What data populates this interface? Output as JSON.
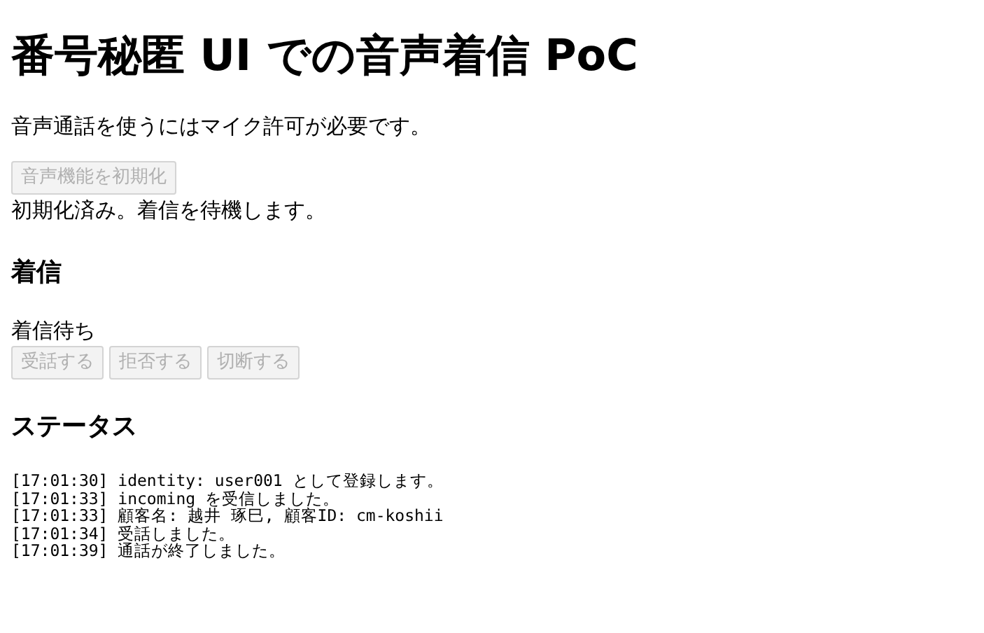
{
  "title": "番号秘匿 UI での音声着信 PoC",
  "intro": "音声通話を使うにはマイク許可が必要です。",
  "init_button": {
    "label": "音声機能を初期化",
    "disabled": true
  },
  "init_status": "初期化済み。着信を待機します。",
  "incoming": {
    "heading": "着信",
    "state": "着信待ち",
    "buttons": [
      {
        "label": "受話する",
        "disabled": true
      },
      {
        "label": "拒否する",
        "disabled": true
      },
      {
        "label": "切断する",
        "disabled": true
      }
    ]
  },
  "status": {
    "heading": "ステータス",
    "log": [
      "[17:01:30] identity: user001 として登録します。",
      "[17:01:33] incoming を受信しました。",
      "[17:01:33] 顧客名: 越井 琢巳, 顧客ID: cm-koshii",
      "[17:01:34] 受話しました。",
      "[17:01:39] 通話が終了しました。"
    ]
  }
}
